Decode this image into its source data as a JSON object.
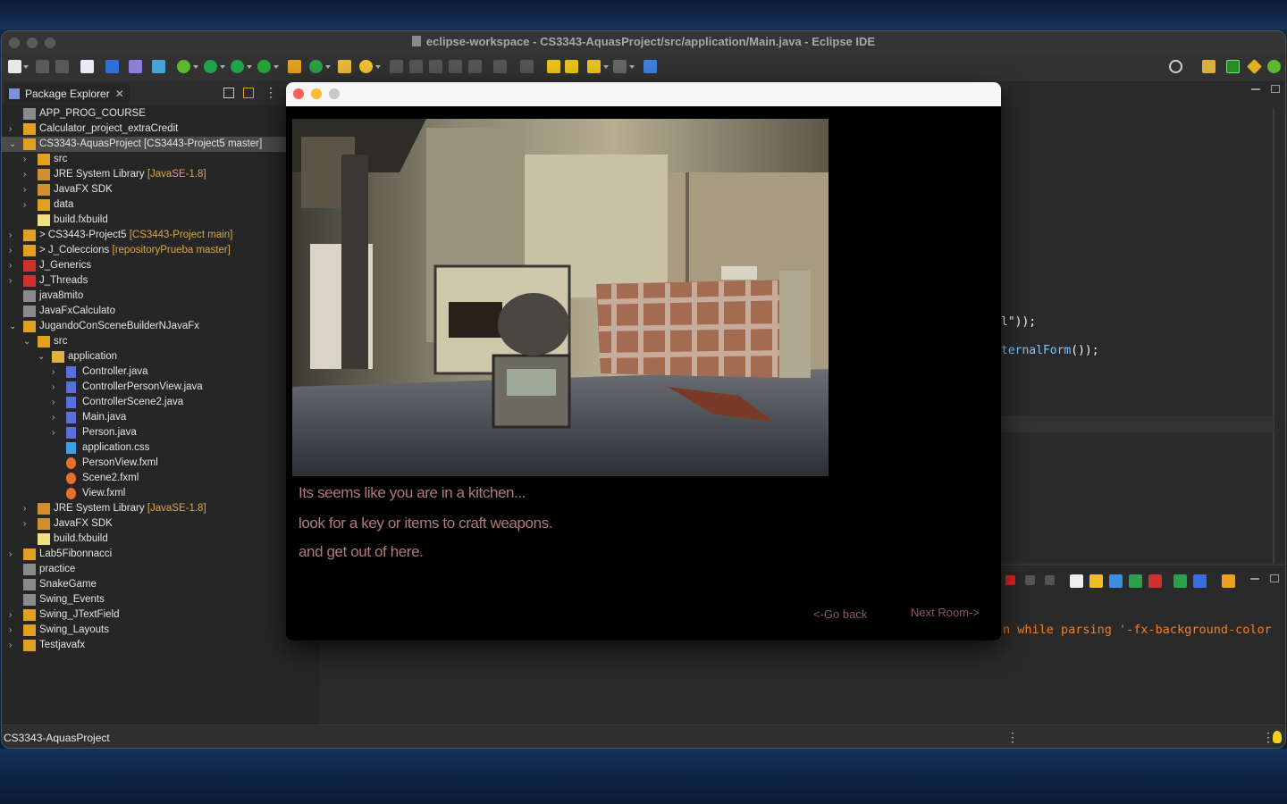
{
  "window": {
    "title": "eclipse-workspace - CS3343-AquasProject/src/application/Main.java - Eclipse IDE"
  },
  "package_explorer": {
    "tab_label": "Package Explorer",
    "close_glyph": "✕",
    "items": [
      {
        "label": "APP_PROG_COURSE",
        "deco": ""
      },
      {
        "label": "Calculator_project_extraCredit",
        "deco": ""
      },
      {
        "label": "CS3343-AquasProject [CS3443-Project5 master]",
        "deco": ""
      },
      {
        "label": "src",
        "deco": ""
      },
      {
        "label": "JRE System Library",
        "deco": "[JavaSE-1.8]"
      },
      {
        "label": "JavaFX SDK",
        "deco": ""
      },
      {
        "label": "data",
        "deco": ""
      },
      {
        "label": "build.fxbuild",
        "deco": ""
      },
      {
        "label": "> CS3443-Project5",
        "deco": "[CS3443-Project main]"
      },
      {
        "label": "> J_Coleccions",
        "deco": "[repositoryPrueba master]"
      },
      {
        "label": "J_Generics",
        "deco": ""
      },
      {
        "label": "J_Threads",
        "deco": ""
      },
      {
        "label": "java8mito",
        "deco": ""
      },
      {
        "label": "JavaFxCalculato",
        "deco": ""
      },
      {
        "label": "JugandoConSceneBuilderNJavaFx",
        "deco": ""
      },
      {
        "label": "src",
        "deco": ""
      },
      {
        "label": "application",
        "deco": ""
      },
      {
        "label": "Controller.java",
        "deco": ""
      },
      {
        "label": "ControllerPersonView.java",
        "deco": ""
      },
      {
        "label": "ControllerScene2.java",
        "deco": ""
      },
      {
        "label": "Main.java",
        "deco": ""
      },
      {
        "label": "Person.java",
        "deco": ""
      },
      {
        "label": "application.css",
        "deco": ""
      },
      {
        "label": "PersonView.fxml",
        "deco": ""
      },
      {
        "label": "Scene2.fxml",
        "deco": ""
      },
      {
        "label": "View.fxml",
        "deco": ""
      },
      {
        "label": "JRE System Library",
        "deco": "[JavaSE-1.8]"
      },
      {
        "label": "JavaFX SDK",
        "deco": ""
      },
      {
        "label": "build.fxbuild",
        "deco": ""
      },
      {
        "label": "Lab5Fibonnacci",
        "deco": ""
      },
      {
        "label": "practice",
        "deco": ""
      },
      {
        "label": "SnakeGame",
        "deco": ""
      },
      {
        "label": "Swing_Events",
        "deco": ""
      },
      {
        "label": "Swing_JTextField",
        "deco": ""
      },
      {
        "label": "Swing_Layouts",
        "deco": ""
      },
      {
        "label": "Testjavafx",
        "deco": ""
      }
    ]
  },
  "editor": {
    "line1": "l\"));",
    "line2_fn": "ternalForm",
    "line2_rest": "());"
  },
  "console": {
    "error_text": "n while parsing '-fx-background-color"
  },
  "status": {
    "text": "CS3343-AquasProject"
  },
  "game": {
    "line1": "Its seems like you are in a kitchen...",
    "line2": "look for a key or items to craft weapons.",
    "line3": "and get out of here.",
    "back_label": "<-Go back",
    "next_label": "Next Room->"
  },
  "colors": {
    "story_text": "#b07a7a",
    "nav_text": "#8c5a5a",
    "console_error": "#ff7b1a"
  }
}
